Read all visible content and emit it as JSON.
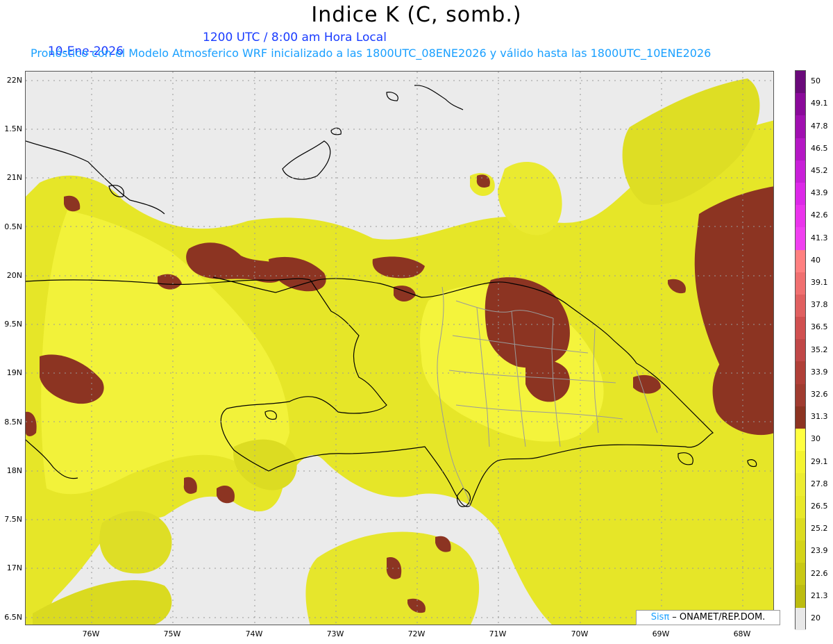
{
  "header": {
    "title": "Indice K (C, somb.)",
    "date": "10-Ene-2026",
    "time": "1200 UTC / 8:00 am Hora Local",
    "subtitle": "Pronóstico con el Modelo Atmosferico WRF inicializado a las 1800UTC_08ENE2026 y válido hasta las  1800UTC_10ENE2026"
  },
  "map": {
    "lat_labels": [
      "22N",
      "1.5N",
      "21N",
      "0.5N",
      "20N",
      "9.5N",
      "19N",
      "8.5N",
      "18N",
      "7.5N",
      "17N",
      "6.5N"
    ],
    "lon_labels": [
      "76W",
      "75W",
      "74W",
      "73W",
      "72W",
      "71W",
      "70W",
      "69W",
      "68W"
    ]
  },
  "legend": {
    "labels": [
      "50",
      "49.1",
      "47.8",
      "46.5",
      "45.2",
      "43.9",
      "42.6",
      "41.3",
      "40",
      "39.1",
      "37.8",
      "36.5",
      "35.2",
      "33.9",
      "32.6",
      "31.3",
      "30",
      "29.1",
      "27.8",
      "26.5",
      "25.2",
      "23.9",
      "22.6",
      "21.3",
      "20"
    ],
    "colors": [
      "#6a0a7a",
      "#8a0a9a",
      "#a010b0",
      "#b418c4",
      "#c820d8",
      "#dc28e8",
      "#ea34ec",
      "#f040f0",
      "#ff8080",
      "#f07070",
      "#e06060",
      "#d05050",
      "#c04848",
      "#b04038",
      "#a03c30",
      "#8c3422",
      "#ffff40",
      "#f4f430",
      "#ecec30",
      "#e8e828",
      "#dcdc20",
      "#d4d418",
      "#c8c814",
      "#bcbc10",
      "#e8e8e8"
    ]
  },
  "credit": {
    "brand": "Sisπ",
    "text": " – ONAMET/REP.DOM."
  }
}
